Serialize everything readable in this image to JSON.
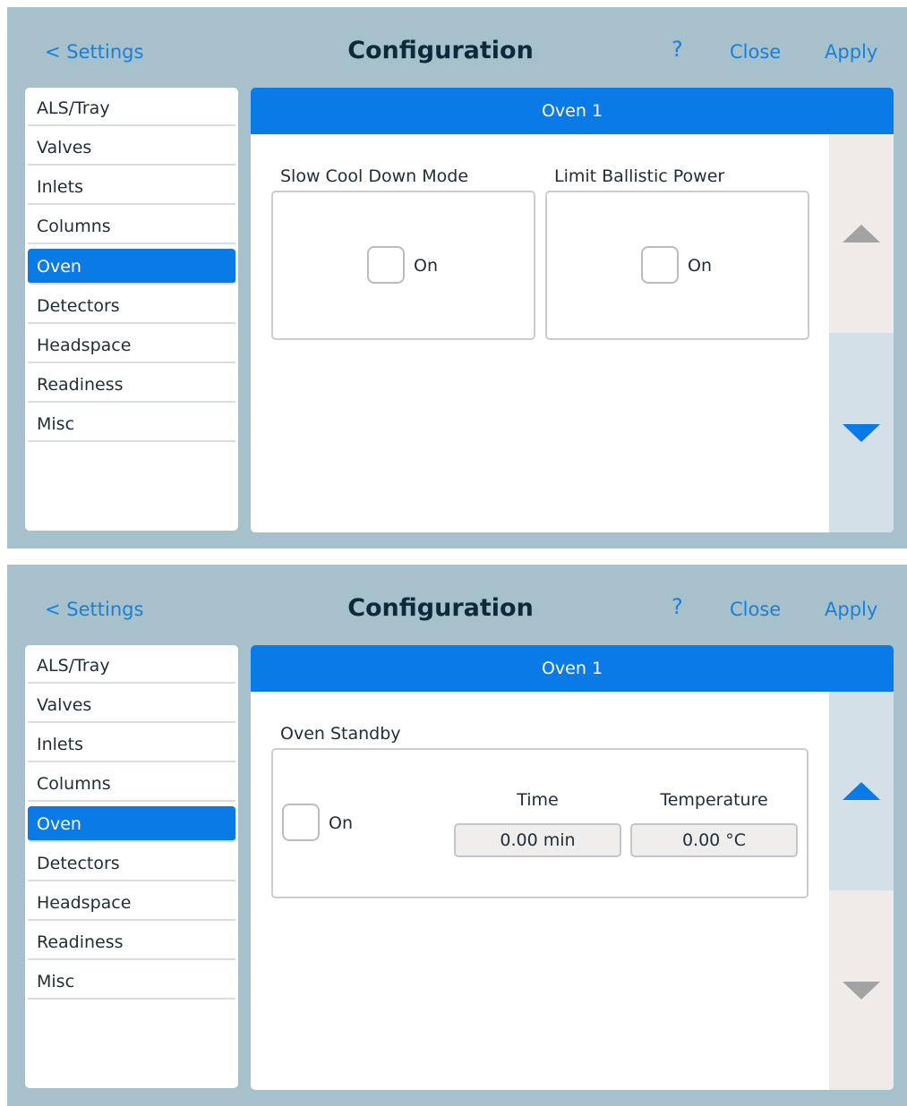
{
  "header": {
    "back_label": "< Settings",
    "title": "Configuration",
    "help_label": "?",
    "close_label": "Close",
    "apply_label": "Apply"
  },
  "sidebar": {
    "items": [
      {
        "label": "ALS/Tray"
      },
      {
        "label": "Valves"
      },
      {
        "label": "Inlets"
      },
      {
        "label": "Columns"
      },
      {
        "label": "Oven"
      },
      {
        "label": "Detectors"
      },
      {
        "label": "Headspace"
      },
      {
        "label": "Readiness"
      },
      {
        "label": "Misc"
      }
    ],
    "active": "Oven"
  },
  "screen1": {
    "section_title": "Oven 1",
    "slow_cool": {
      "label": "Slow Cool Down Mode",
      "checkbox_label": "On",
      "checked": false
    },
    "limit_ballistic": {
      "label": "Limit Ballistic Power",
      "checkbox_label": "On",
      "checked": false
    },
    "scroll": {
      "up_enabled": false,
      "down_enabled": true
    }
  },
  "screen2": {
    "section_title": "Oven 1",
    "standby": {
      "label": "Oven Standby",
      "checkbox_label": "On",
      "checked": false,
      "time_label": "Time",
      "time_value": "0.00 min",
      "temp_label": "Temperature",
      "temp_value": "0.00 °C"
    },
    "scroll": {
      "up_enabled": true,
      "down_enabled": false
    }
  },
  "colors": {
    "frame": "#a7c1cc",
    "accent": "#0a7ae6",
    "link": "#1a7fd8",
    "title": "#0d2a3d"
  }
}
